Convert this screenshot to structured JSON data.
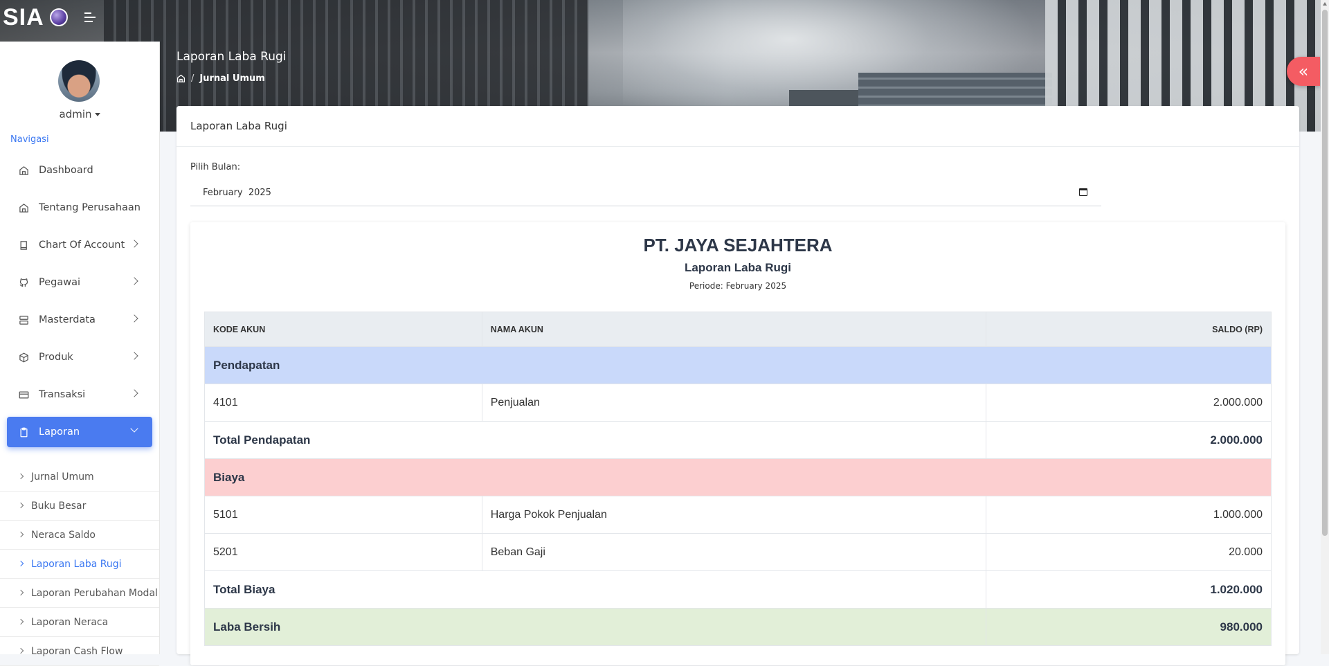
{
  "brand": {
    "text": "SIA"
  },
  "header": {
    "page_title": "Laporan Laba Rugi",
    "breadcrumb": {
      "current": "Jurnal Umum"
    }
  },
  "user": {
    "name": "admin"
  },
  "sidebar": {
    "section_label": "Navigasi",
    "items": [
      {
        "label": "Dashboard",
        "icon": "home-icon",
        "has_children": false
      },
      {
        "label": "Tentang Perusahaan",
        "icon": "home-icon",
        "has_children": false
      },
      {
        "label": "Chart Of Account",
        "icon": "book-icon",
        "has_children": true
      },
      {
        "label": "Pegawai",
        "icon": "github-icon",
        "has_children": true
      },
      {
        "label": "Masterdata",
        "icon": "server-icon",
        "has_children": true
      },
      {
        "label": "Produk",
        "icon": "box-icon",
        "has_children": true
      },
      {
        "label": "Transaksi",
        "icon": "credit-card-icon",
        "has_children": true
      },
      {
        "label": "Laporan",
        "icon": "clipboard-icon",
        "has_children": true,
        "active": true
      }
    ],
    "subitems": [
      {
        "label": "Jurnal Umum"
      },
      {
        "label": "Buku Besar"
      },
      {
        "label": "Neraca Saldo"
      },
      {
        "label": "Laporan Laba Rugi",
        "active": true
      },
      {
        "label": "Laporan Perubahan Modal"
      },
      {
        "label": "Laporan Neraca"
      },
      {
        "label": "Laporan Cash Flow"
      }
    ]
  },
  "card": {
    "title": "Laporan Laba Rugi",
    "month_label": "Pilih Bulan:",
    "month_value": "February  2025"
  },
  "report": {
    "company": "PT. JAYA SEJAHTERA",
    "title": "Laporan Laba Rugi",
    "period": "Periode: February 2025",
    "columns": [
      "KODE AKUN",
      "NAMA AKUN",
      "SALDO (RP)"
    ],
    "sections": {
      "pendapatan": {
        "label": "Pendapatan",
        "rows": [
          {
            "code": "4101",
            "name": "Penjualan",
            "amount": "2.000.000"
          }
        ],
        "total_label": "Total Pendapatan",
        "total": "2.000.000"
      },
      "biaya": {
        "label": "Biaya",
        "rows": [
          {
            "code": "5101",
            "name": "Harga Pokok Penjualan",
            "amount": "1.000.000"
          },
          {
            "code": "5201",
            "name": "Beban Gaji",
            "amount": "20.000"
          }
        ],
        "total_label": "Total Biaya",
        "total": "1.020.000"
      }
    },
    "net_label": "Laba Bersih",
    "net": "980.000"
  },
  "colors": {
    "accent": "#4a7bf0",
    "collapse_button": "#f45c63",
    "pendapatan_bg": "#c9d9fa",
    "biaya_bg": "#fccfd0",
    "net_bg": "#e2efd8"
  }
}
